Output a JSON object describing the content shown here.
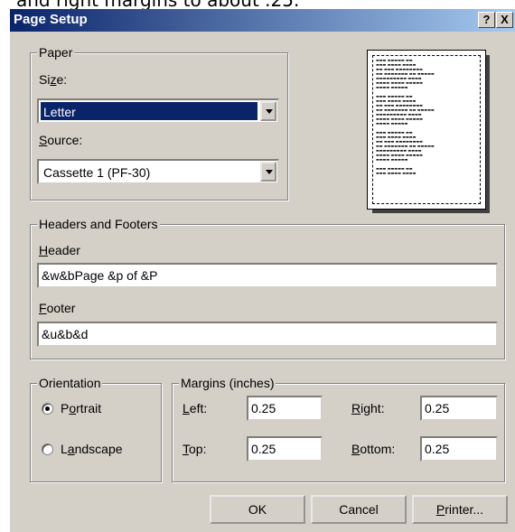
{
  "background_caption": "and right margins to about .25.",
  "window": {
    "title": "Page Setup",
    "help_button": "?",
    "close_button": "X"
  },
  "paper": {
    "legend": "Paper",
    "size_label": "Size:",
    "size_value": "Letter",
    "source_label": "Source:",
    "source_value": "Cassette 1 (PF-30)"
  },
  "headers_footers": {
    "legend": "Headers and Footers",
    "header_label": "Header",
    "header_value": "&w&bPage &p of &P",
    "footer_label": "Footer",
    "footer_value": "&u&b&d"
  },
  "orientation": {
    "legend": "Orientation",
    "portrait_label": "Portrait",
    "landscape_label": "Landscape",
    "selected": "Portrait"
  },
  "margins": {
    "legend": "Margins (inches)",
    "left_label": "Left:",
    "left_value": "0.25",
    "right_label": "Right:",
    "right_value": "0.25",
    "top_label": "Top:",
    "top_value": "0.25",
    "bottom_label": "Bottom:",
    "bottom_value": "0.25"
  },
  "buttons": {
    "ok": "OK",
    "cancel": "Cancel",
    "printer": "Printer..."
  },
  "colors": {
    "dialog_face": "#d4d0c8",
    "title_gradient_start": "#0a246a",
    "title_gradient_end": "#a6caf0",
    "selection": "#0a246a"
  }
}
